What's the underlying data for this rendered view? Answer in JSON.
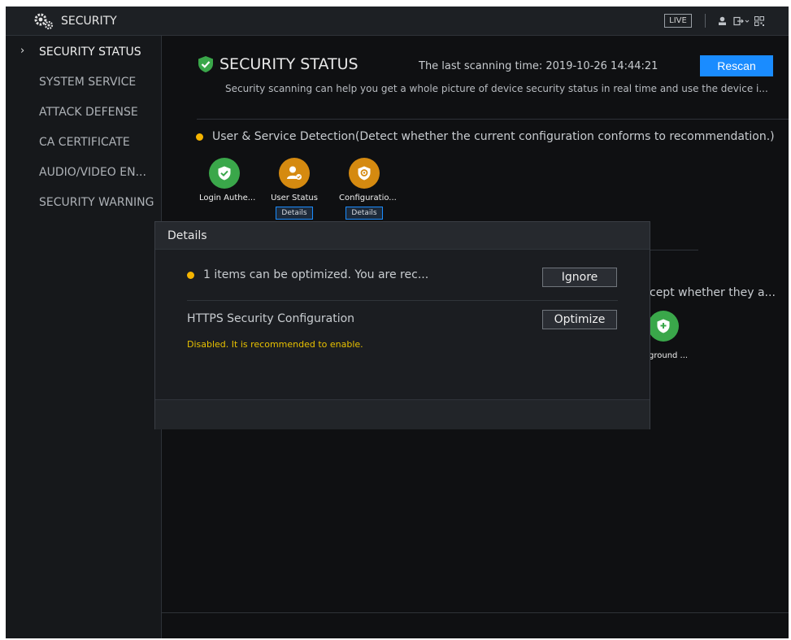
{
  "app": {
    "title": "SECURITY",
    "live_label": "LIVE"
  },
  "sidebar": {
    "items": [
      {
        "label": "SECURITY STATUS",
        "active": true
      },
      {
        "label": "SYSTEM SERVICE"
      },
      {
        "label": "ATTACK DEFENSE"
      },
      {
        "label": "CA CERTIFICATE"
      },
      {
        "label": "AUDIO/VIDEO EN..."
      },
      {
        "label": "SECURITY WARNING"
      }
    ]
  },
  "main": {
    "title": "SECURITY STATUS",
    "last_scan_label": "The last scanning time: 2019-10-26 14:44:21",
    "rescan_label": "Rescan",
    "description": "Security scanning can help you get a whole picture of device security status in real time and use the device i...",
    "section1": {
      "title": "User & Service Detection(Detect whether the current configuration conforms to recommendation.)",
      "items": [
        {
          "label": "Login Authe...",
          "status": "ok"
        },
        {
          "label": "User Status",
          "status": "warning",
          "details": "Details"
        },
        {
          "label": "Configuratio...",
          "status": "warning",
          "details": "Details"
        }
      ]
    },
    "section2": {
      "partial_title": "cept whether they a...",
      "partial_item_label": "ground ..."
    }
  },
  "modal": {
    "title": "Details",
    "summary": "1 items can be optimized. You are rec...",
    "ignore_label": "Ignore",
    "item_title": "HTTPS Security Configuration",
    "optimize_label": "Optimize",
    "item_warning": "Disabled. It is recommended to enable."
  },
  "colors": {
    "accent": "#1a8cff",
    "ok": "#3aa74a",
    "warning": "#d58a10",
    "warning_text": "#e8c100"
  }
}
